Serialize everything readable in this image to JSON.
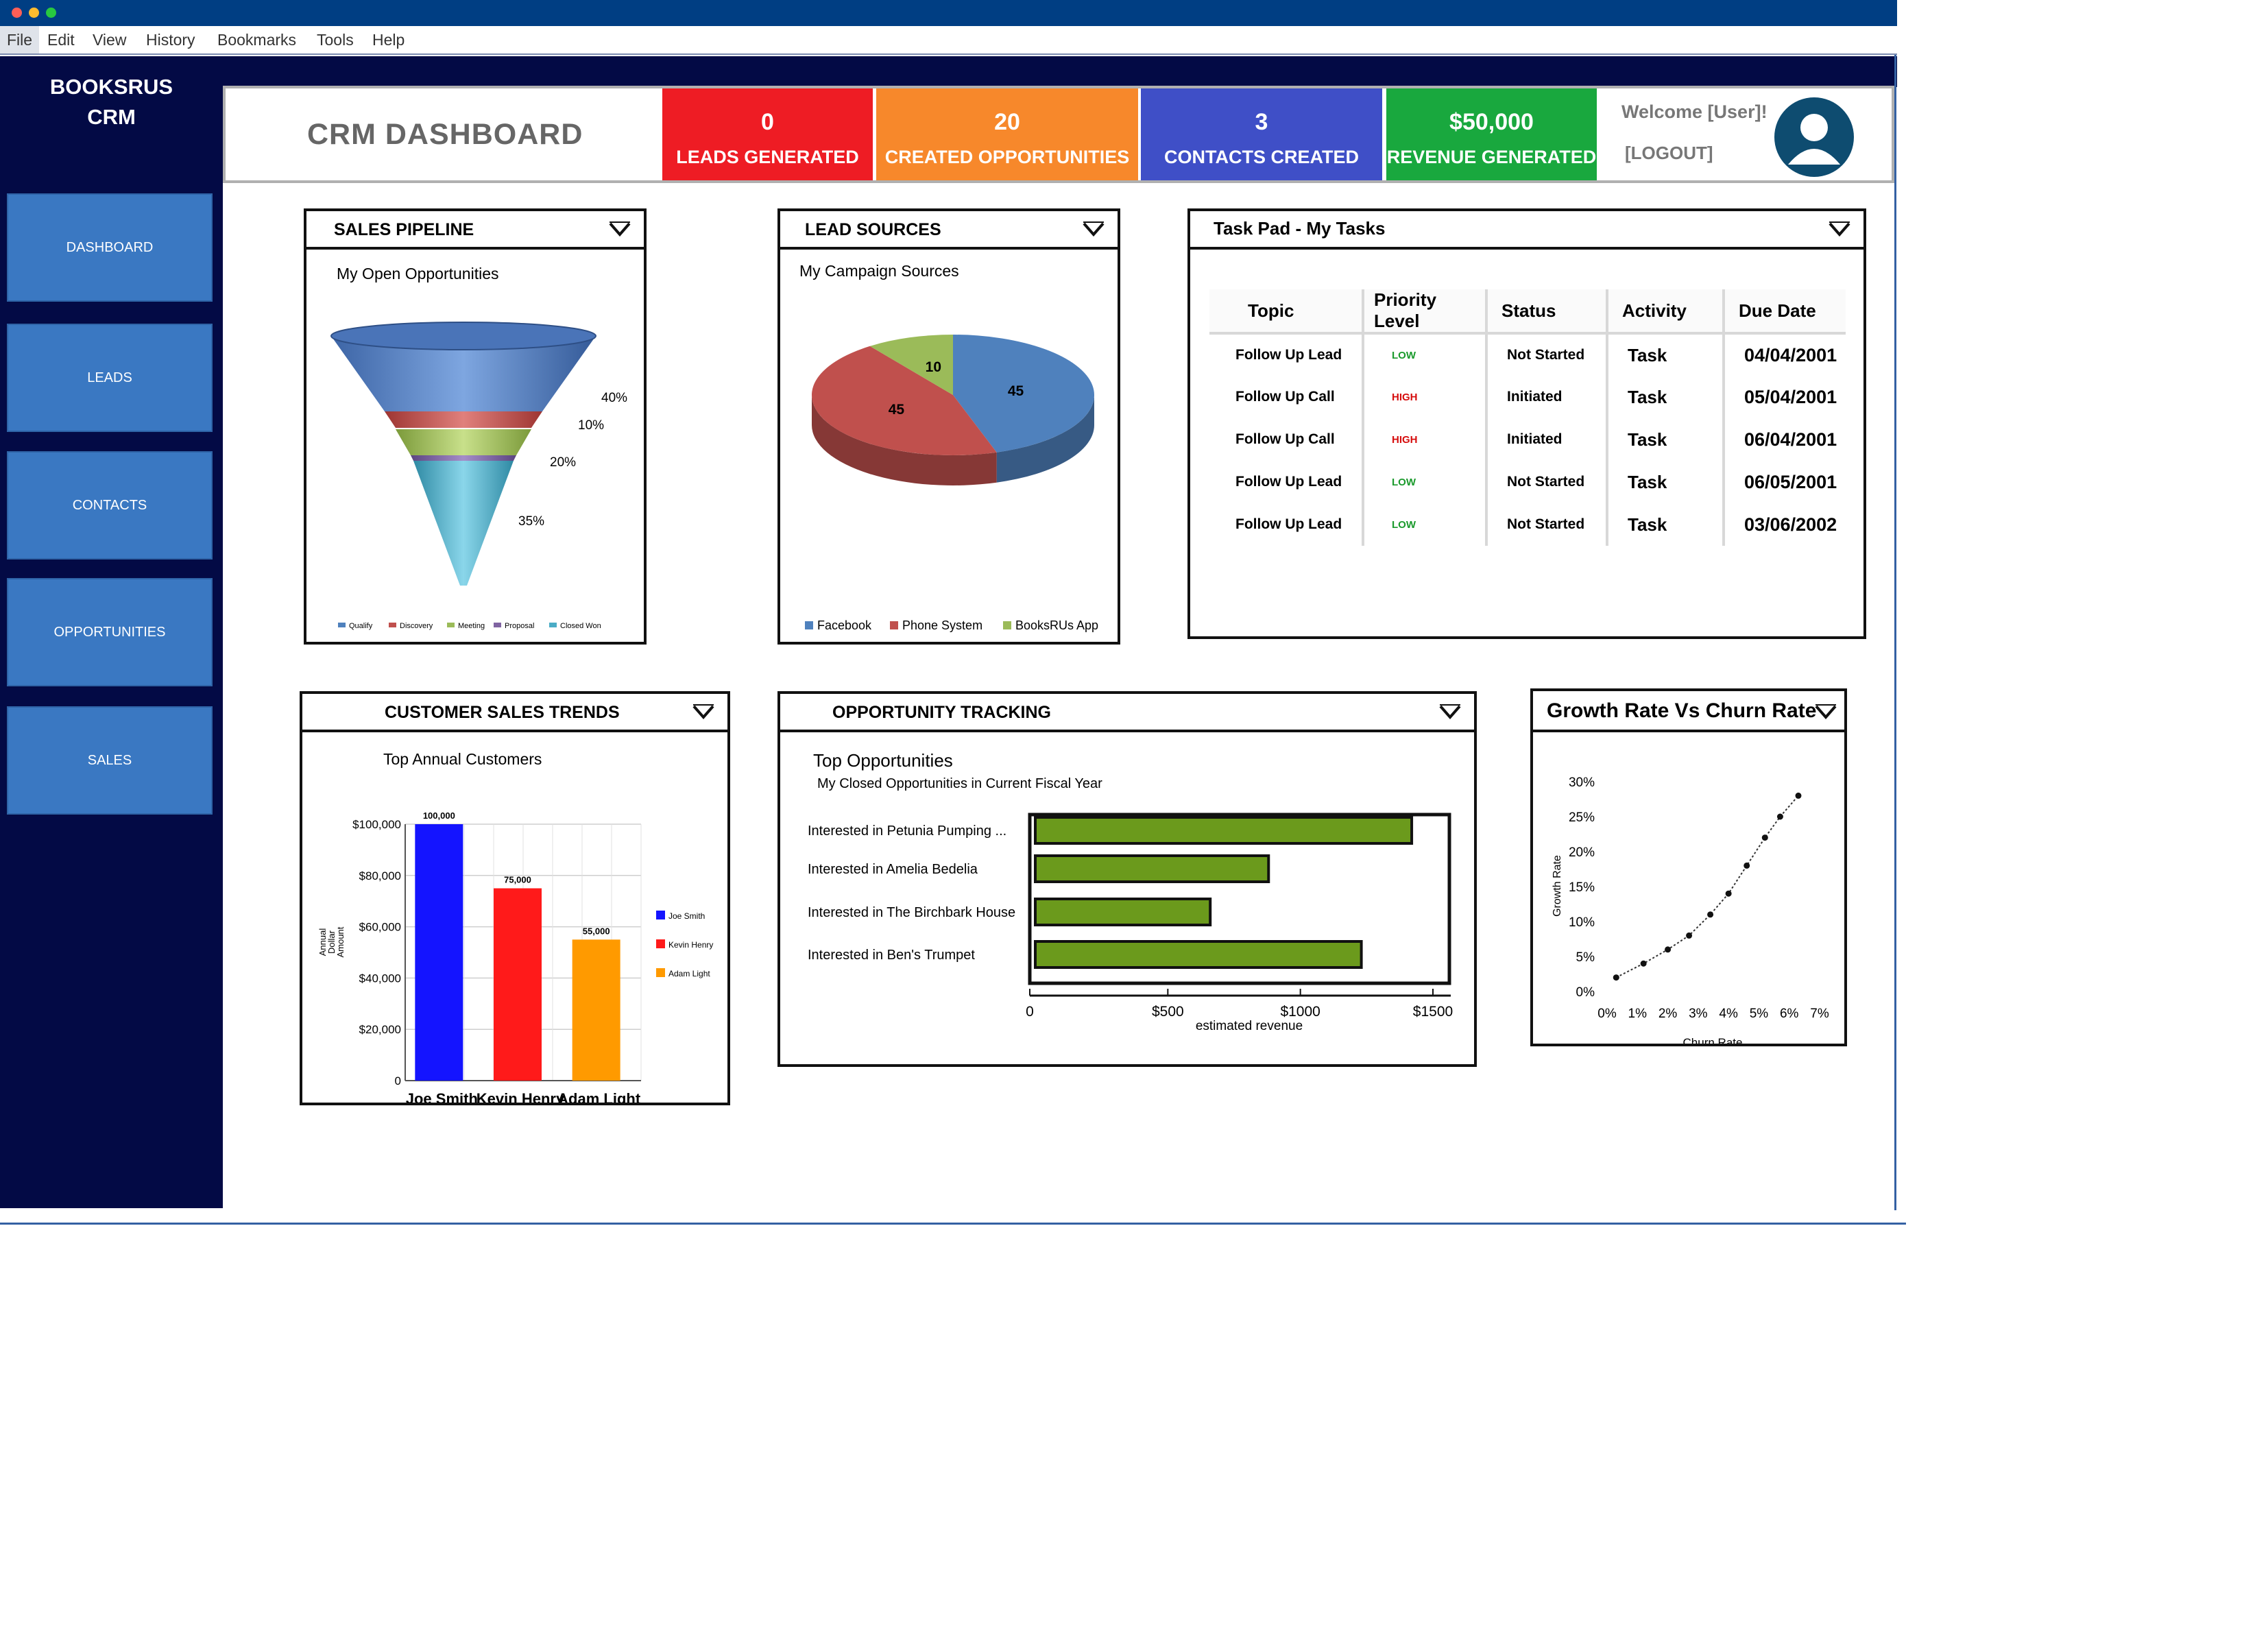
{
  "menu": [
    "File",
    "Edit",
    "View",
    "History",
    "Bookmarks",
    "Tools",
    "Help"
  ],
  "brand": {
    "line1": "BOOKSRUS",
    "line2": "CRM"
  },
  "sidebar": {
    "items": [
      {
        "label": "DASHBOARD"
      },
      {
        "label": "LEADS"
      },
      {
        "label": "CONTACTS"
      },
      {
        "label": "OPPORTUNITIES"
      },
      {
        "label": "SALES"
      }
    ]
  },
  "header": {
    "title": "CRM DASHBOARD",
    "kpis": [
      {
        "value": "0",
        "label": "LEADS GENERATED",
        "color": "#ee1c24"
      },
      {
        "value": "20",
        "label": "CREATED OPPORTUNITIES",
        "color": "#f7882b"
      },
      {
        "value": "3",
        "label": "CONTACTS CREATED",
        "color": "#3f4fc7"
      },
      {
        "value": "$50,000",
        "label": "REVENUE GENERATED",
        "color": "#19a83e"
      }
    ],
    "welcome": "Welcome [User]!",
    "logout": "[LOGOUT]"
  },
  "colors": {
    "navy": "#030a45",
    "nav_button": "#3a78c2",
    "titlebar": "#003e83"
  },
  "pipeline": {
    "title": "SALES PIPELINE",
    "subtitle": "My Open Opportunities",
    "chart_data": {
      "type": "funnel",
      "stages": [
        "Qualify",
        "Discovery",
        "Meeting",
        "Proposal",
        "Closed Won"
      ],
      "percent_labels": [
        "40%",
        "10%",
        "20%",
        "35%"
      ],
      "colors": [
        "#4f81bd",
        "#c0504d",
        "#9bbb59",
        "#8064a2",
        "#4bacc6"
      ]
    }
  },
  "lead_sources": {
    "title": "LEAD SOURCES",
    "subtitle": "My Campaign Sources",
    "chart_data": {
      "type": "pie",
      "labels": [
        "Facebook",
        "Phone System",
        "BooksRUs App"
      ],
      "values": [
        45,
        45,
        10
      ],
      "colors": [
        "#4f81bd",
        "#c0504d",
        "#9bbb59"
      ]
    }
  },
  "tasks": {
    "title": "Task Pad - My Tasks",
    "columns": [
      "Topic",
      "Priority Level",
      "Status",
      "Activity",
      "Due Date"
    ],
    "rows": [
      {
        "topic": "Follow Up Lead",
        "priority": "LOW",
        "status": "Not Started",
        "activity": "Task",
        "due": "04/04/2001"
      },
      {
        "topic": "Follow Up Call",
        "priority": "HIGH",
        "status": "Initiated",
        "activity": "Task",
        "due": "05/04/2001"
      },
      {
        "topic": "Follow Up Call",
        "priority": "HIGH",
        "status": "Initiated",
        "activity": "Task",
        "due": "06/04/2001"
      },
      {
        "topic": "Follow Up Lead",
        "priority": "LOW",
        "status": "Not Started",
        "activity": "Task",
        "due": "06/05/2001"
      },
      {
        "topic": "Follow Up Lead",
        "priority": "LOW",
        "status": "Not Started",
        "activity": "Task",
        "due": "03/06/2002"
      }
    ]
  },
  "customer_trends": {
    "title": "CUSTOMER SALES TRENDS",
    "subtitle": "Top Annual Customers",
    "chart_data": {
      "type": "bar",
      "categories": [
        "Joe Smith",
        "Kevin Henry",
        "Adam Light"
      ],
      "values": [
        100000,
        75000,
        55000
      ],
      "value_labels": [
        "100,000",
        "75,000",
        "55,000"
      ],
      "colors": [
        "#1414ff",
        "#ff1a1a",
        "#ff9a00"
      ],
      "ylabel": "Annual Dollar Amount",
      "ylim": [
        0,
        100000
      ],
      "yticks": [
        "0",
        "$20,000",
        "$40,000",
        "$60,000",
        "$80,000",
        "$100,000"
      ],
      "legend": "right"
    }
  },
  "opportunity_tracking": {
    "title": "OPPORTUNITY TRACKING",
    "subtitle": "Top Opportunities",
    "subtitle2": "My Closed Opportunities in Current Fiscal Year",
    "chart_data": {
      "type": "bar",
      "orientation": "horizontal",
      "categories": [
        "Interested  in Petunia Pumping ...",
        "Interested in Amelia Bedelia",
        "Interested in The Birchbark House",
        "Interested in Ben's Trumpet"
      ],
      "values": [
        1420,
        880,
        660,
        1230
      ],
      "xlim": [
        0,
        1500
      ],
      "xticks": [
        "0",
        "$500",
        "$1000",
        "$1500"
      ],
      "xlabel": "estimated revenue",
      "color": "#6b9a1c"
    }
  },
  "growth": {
    "title": "Growth Rate Vs Churn Rate",
    "chart_data": {
      "type": "scatter",
      "x": [
        0.3,
        1.2,
        2.0,
        2.7,
        3.4,
        4.0,
        4.6,
        5.2,
        5.7,
        6.3
      ],
      "y": [
        2,
        4,
        6,
        8,
        11,
        14,
        18,
        22,
        25,
        28
      ],
      "xlabel": "Churn Rate",
      "ylabel": "Growth Rate",
      "xlim": [
        0,
        7
      ],
      "ylim": [
        0,
        30
      ],
      "xticks": [
        "0%",
        "1%",
        "2%",
        "3%",
        "4%",
        "5%",
        "6%",
        "7%"
      ],
      "yticks": [
        "0%",
        "5%",
        "10%",
        "15%",
        "20%",
        "25%",
        "30%"
      ]
    }
  }
}
